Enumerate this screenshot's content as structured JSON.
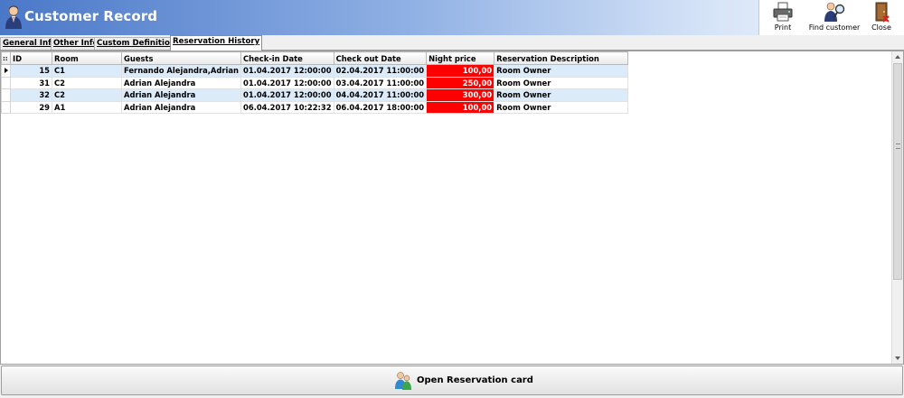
{
  "window": {
    "title": "Customer Record"
  },
  "toolbar": {
    "print_label": "Print",
    "find_label": "Find customer",
    "close_label": "Close"
  },
  "tabs": [
    {
      "label": "General Info",
      "active": false
    },
    {
      "label": "Other Info",
      "active": false
    },
    {
      "label": "Custom Definitions",
      "active": false
    },
    {
      "label": "Reservation History",
      "active": true
    }
  ],
  "grid": {
    "corner_glyph": "::",
    "columns": [
      "ID",
      "Room",
      "Guests",
      "Check-in Date",
      "Check out Date",
      "Night price",
      "Reservation Description"
    ],
    "rows": [
      {
        "id": "15",
        "room": "C1",
        "guests": "Fernando Alejandra,Adrian",
        "checkin": "01.04.2017 12:00:00",
        "checkout": "02.04.2017 11:00:00",
        "price": "100,00",
        "description": "Room Owner"
      },
      {
        "id": "31",
        "room": "C2",
        "guests": "Adrian Alejandra",
        "checkin": "01.04.2017 12:00:00",
        "checkout": "03.04.2017 11:00:00",
        "price": "250,00",
        "description": "Room Owner"
      },
      {
        "id": "32",
        "room": "C2",
        "guests": "Adrian Alejandra",
        "checkin": "01.04.2017 12:00:00",
        "checkout": "04.04.2017 11:00:00",
        "price": "300,00",
        "description": "Room Owner"
      },
      {
        "id": "29",
        "room": "A1",
        "guests": "Adrian Alejandra",
        "checkin": "06.04.2017 10:22:32",
        "checkout": "06.04.2017 18:00:00",
        "price": "100,00",
        "description": "Room Owner"
      }
    ],
    "price_highlight_color": "#ff0000",
    "alt_row_color": "#dcebfa"
  },
  "footer": {
    "open_button_label": "Open Reservation card"
  },
  "colors": {
    "header_start": "#4a78c8",
    "header_end": "#eef3fb"
  }
}
